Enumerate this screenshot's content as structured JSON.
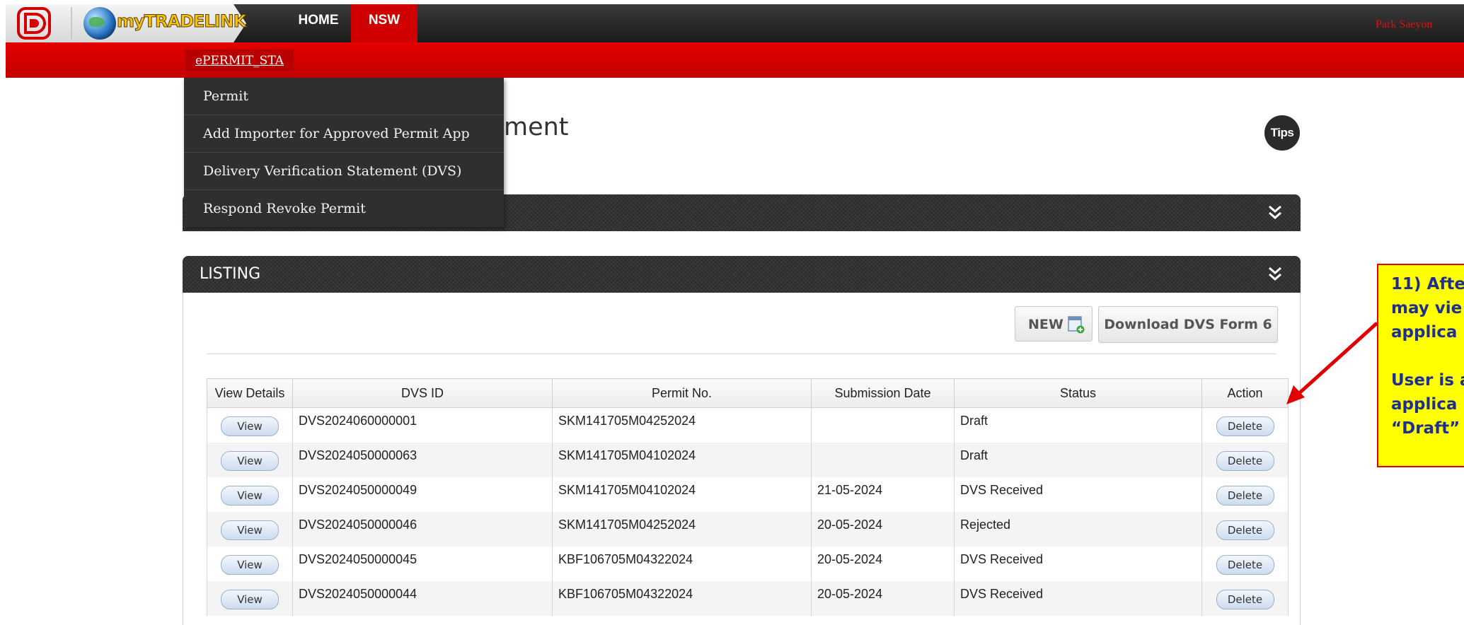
{
  "header": {
    "brand": "myTRADELINK",
    "nav": [
      {
        "label": "HOME",
        "active": false
      },
      {
        "label": "NSW",
        "active": true
      }
    ],
    "user": "Park Saeyon",
    "colors": {
      "topbar": "#222222",
      "accent": "#d10000",
      "user_text": "#e01010"
    }
  },
  "subnav": {
    "active_item": "ePERMIT_STA"
  },
  "dropdown": {
    "items": [
      "Permit",
      "Add Importer for Approved Permit App",
      "Delivery Verification Statement (DVS)",
      "Respond Revoke Permit"
    ]
  },
  "page": {
    "heading_visible": "ment",
    "tips_label": "Tips"
  },
  "listing": {
    "title": "LISTING",
    "new_button": "NEW",
    "download_button": "Download DVS Form 6",
    "columns": [
      "View Details",
      "DVS ID",
      "Permit No.",
      "Submission Date",
      "Status",
      "Action"
    ],
    "rows": [
      {
        "view": "View",
        "dvs_id": "DVS2024060000001",
        "permit_no": "SKM141705M04252024",
        "date": "",
        "status": "Draft",
        "action": "Delete"
      },
      {
        "view": "View",
        "dvs_id": "DVS2024050000063",
        "permit_no": "SKM141705M04102024",
        "date": "",
        "status": "Draft",
        "action": "Delete"
      },
      {
        "view": "View",
        "dvs_id": "DVS2024050000049",
        "permit_no": "SKM141705M04102024",
        "date": "21-05-2024",
        "status": "DVS Received",
        "action": "Delete"
      },
      {
        "view": "View",
        "dvs_id": "DVS2024050000046",
        "permit_no": "SKM141705M04252024",
        "date": "20-05-2024",
        "status": "Rejected",
        "action": "Delete"
      },
      {
        "view": "View",
        "dvs_id": "DVS2024050000045",
        "permit_no": "KBF106705M04322024",
        "date": "20-05-2024",
        "status": "DVS Received",
        "action": "Delete"
      },
      {
        "view": "View",
        "dvs_id": "DVS2024050000044",
        "permit_no": "KBF106705M04322024",
        "date": "20-05-2024",
        "status": "DVS Received",
        "action": "Delete"
      }
    ]
  },
  "annotation": {
    "text": "11) Afte\nmay vie\napplica\n\nUser is a\napplica\n“Draft”",
    "colors": {
      "background": "#ffff00",
      "border": "#e00000",
      "text": "#1f2f8f",
      "arrow": "#e00000"
    }
  }
}
